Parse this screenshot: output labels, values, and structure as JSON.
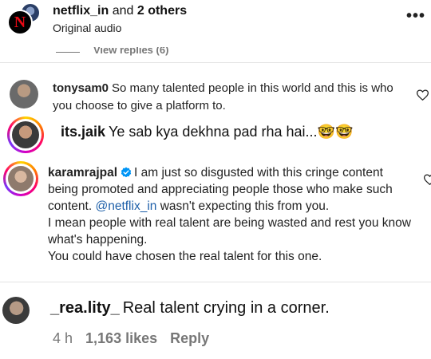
{
  "header": {
    "account": "netflix_in",
    "connector": "and",
    "others": "2 others",
    "subtitle": "Original audio",
    "more_icon": "more-icon",
    "netflix_letter": "N"
  },
  "view_replies": "View replies (6)",
  "comments": [
    {
      "username": "tonysam0",
      "text": "So many talented people in this world and this is who you choose to give a platform to."
    },
    {
      "username": "its.jaik",
      "text": "Ye sab kya dekhna pad rha hai...🤓🤓"
    },
    {
      "username": "karamrajpal",
      "text_1": "I am just so disgusted with this cringe content being promoted and appreciating people those who make such content.",
      "mention": "@netflix_in",
      "text_2": "wasn't expecting this from you.",
      "text_3": "I mean people with real talent are being wasted and rest you know what's happening.",
      "text_4": "You could have chosen the real talent for this one."
    },
    {
      "username": "_rea.lity_",
      "text": "Real talent crying in a corner.",
      "time": "4 h",
      "likes": "1,163 likes",
      "reply": "Reply"
    }
  ],
  "colors": {
    "mention": "#1d5fa8",
    "netflix_red": "#e50914",
    "verified": "#0095f6"
  }
}
